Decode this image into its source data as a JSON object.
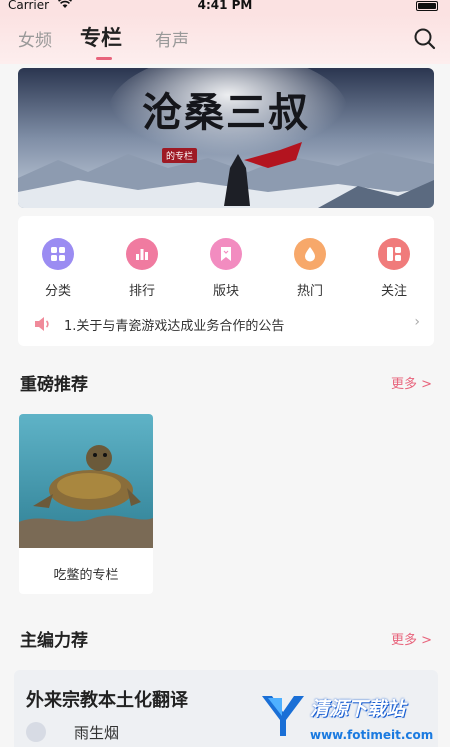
{
  "status_bar": {
    "carrier": "Carrier",
    "time": "4:41 PM"
  },
  "nav": {
    "tabs": [
      {
        "label": "女频",
        "active": false
      },
      {
        "label": "专栏",
        "active": true
      },
      {
        "label": "有声",
        "active": false
      }
    ],
    "accent": "#e8647c"
  },
  "banner": {
    "title": "沧桑三叔",
    "badge": "的专栏"
  },
  "quick_links": [
    {
      "label": "分类",
      "icon": "grid-icon",
      "color": "#9b8cf2"
    },
    {
      "label": "排行",
      "icon": "bar-chart-icon",
      "color": "#f07ba0"
    },
    {
      "label": "版块",
      "icon": "bookmark-icon",
      "color": "#f28cc0"
    },
    {
      "label": "热门",
      "icon": "fire-icon",
      "color": "#f7a86a"
    },
    {
      "label": "关注",
      "icon": "follow-icon",
      "color": "#f07b7b"
    }
  ],
  "notice": {
    "text": "1.关于与青瓷游戏达成业务合作的公告"
  },
  "sections": {
    "featured": {
      "title": "重磅推荐",
      "more": "更多 >"
    },
    "editor": {
      "title": "主编力荐",
      "more": "更多 >"
    }
  },
  "featured_card": {
    "title": "吃鳖的专栏"
  },
  "editor_item": {
    "title": "外来宗教本土化翻译",
    "author": "雨生烟"
  },
  "watermark": {
    "title": "清源下载站",
    "url": "www.fotimeit.com"
  }
}
